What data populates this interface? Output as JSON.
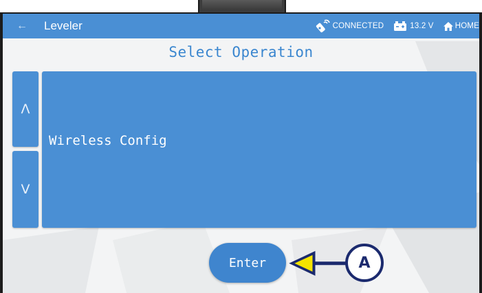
{
  "header": {
    "back_icon": "arrow-left-icon",
    "title": "Leveler",
    "connection_status": "CONNECTED",
    "connection_icon": "wireless-remote-icon",
    "battery_voltage": "13.2 V",
    "battery_icon": "battery-icon",
    "home_label": "HOME",
    "home_icon": "home-icon"
  },
  "main": {
    "title": "Select Operation",
    "up_arrow": "Λ",
    "down_arrow": "V",
    "selected_option": "Wireless Config",
    "enter_label": "Enter"
  },
  "annotation": {
    "callout_label": "A",
    "arrow_color": "#f5e400",
    "badge_color": "#1b2a6e"
  },
  "colors": {
    "accent": "#4a8fd4",
    "title_text": "#3a86cf",
    "background": "#f3f4f5"
  }
}
